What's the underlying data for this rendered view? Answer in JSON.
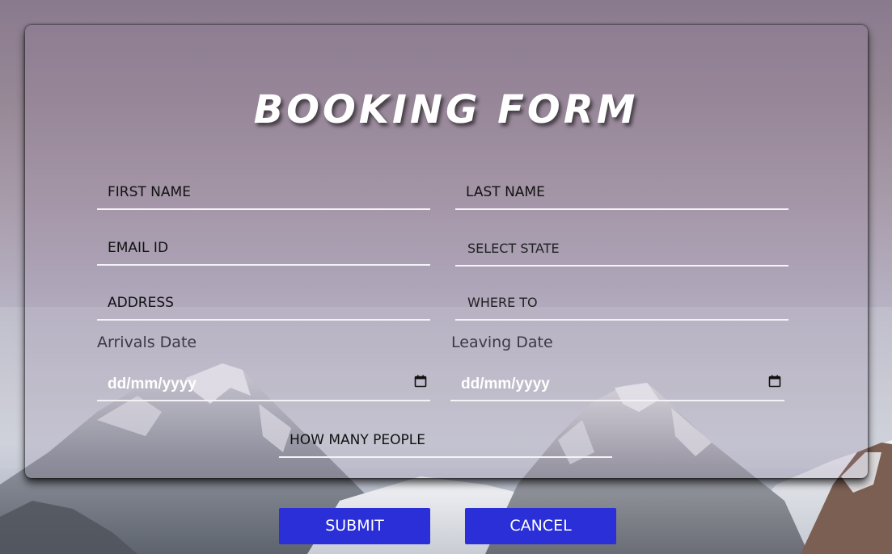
{
  "form": {
    "title": "BOOKING FORM",
    "first_name_placeholder": "FIRST NAME",
    "last_name_placeholder": "LAST NAME",
    "email_placeholder": "EMAIL ID",
    "state_placeholder": "SELECT STATE",
    "address_placeholder": "ADDRESS",
    "where_to_placeholder": "WHERE TO",
    "arrivals_label": "Arrivals Date",
    "leaving_label": "Leaving Date",
    "arrivals_value": "dd/mm/yyyy",
    "leaving_value": "dd/mm/yyyy",
    "people_placeholder": "HOW MANY PEOPLE",
    "submit_label": "SUBMIT",
    "cancel_label": "CANCEL"
  },
  "colors": {
    "button": "#2a2fd8",
    "underline": "#f4f4f6",
    "title": "#ffffff"
  },
  "icons": {
    "date_picker": "calendar-icon"
  }
}
